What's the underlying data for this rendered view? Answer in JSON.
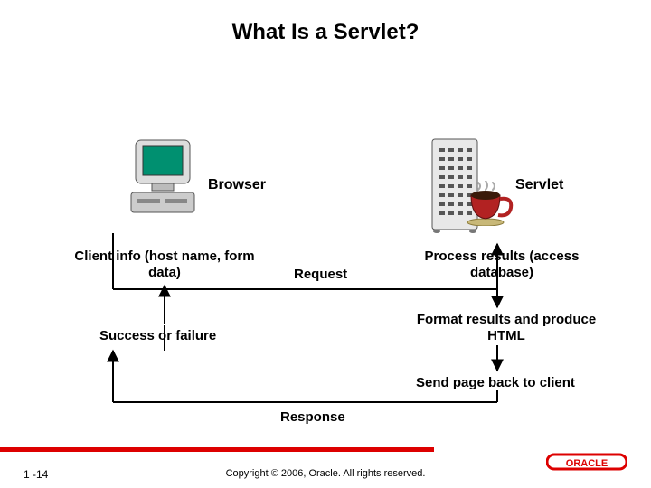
{
  "title": "What Is a Servlet?",
  "labels": {
    "browser": "Browser",
    "servlet": "Servlet",
    "clientinfo": "Client info (host name, form data)",
    "request": "Request",
    "process": "Process results (access database)",
    "success": "Success or failure",
    "format": "Format results and produce HTML",
    "sendpage": "Send page back to client",
    "response": "Response"
  },
  "footer": {
    "slidenum": "1 -14",
    "copyright": "Copyright © 2006, Oracle. All rights reserved.",
    "logo": "ORACLE"
  },
  "icons": {
    "browser": "monitor-computer-icon",
    "server": "server-rack-icon",
    "coffee": "java-coffee-icon"
  },
  "colors": {
    "accent_red": "#d00",
    "cup_body": "#b22222",
    "screen": "#009070"
  }
}
